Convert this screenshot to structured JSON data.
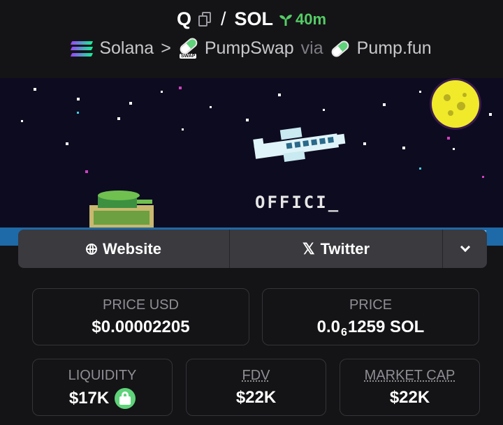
{
  "header": {
    "base_symbol": "Q",
    "separator": "/",
    "quote_symbol": "SOL",
    "age": "40m",
    "chain": "Solana",
    "chevron": ">",
    "dex": "PumpSwap",
    "via": "via",
    "launchpad": "Pump.fun",
    "dex_icon_tag": "SWAP"
  },
  "banner": {
    "text": "OFFICI_"
  },
  "links": {
    "website": "Website",
    "twitter": "Twitter"
  },
  "stats": {
    "price_usd": {
      "label": "PRICE USD",
      "value": "$0.00002205"
    },
    "price": {
      "label": "PRICE",
      "prefix": "0.0",
      "subscript": "6",
      "suffix": "1259 SOL"
    },
    "liquidity": {
      "label": "LIQUIDITY",
      "value": "$17K"
    },
    "fdv": {
      "label": "FDV",
      "value": "$22K"
    },
    "market_cap": {
      "label": "MARKET CAP",
      "value": "$22K"
    }
  },
  "colors": {
    "background": "#141416",
    "accent_green": "#55cc66",
    "banner_bg": "#0d0b20",
    "moon": "#f0ea2a"
  }
}
